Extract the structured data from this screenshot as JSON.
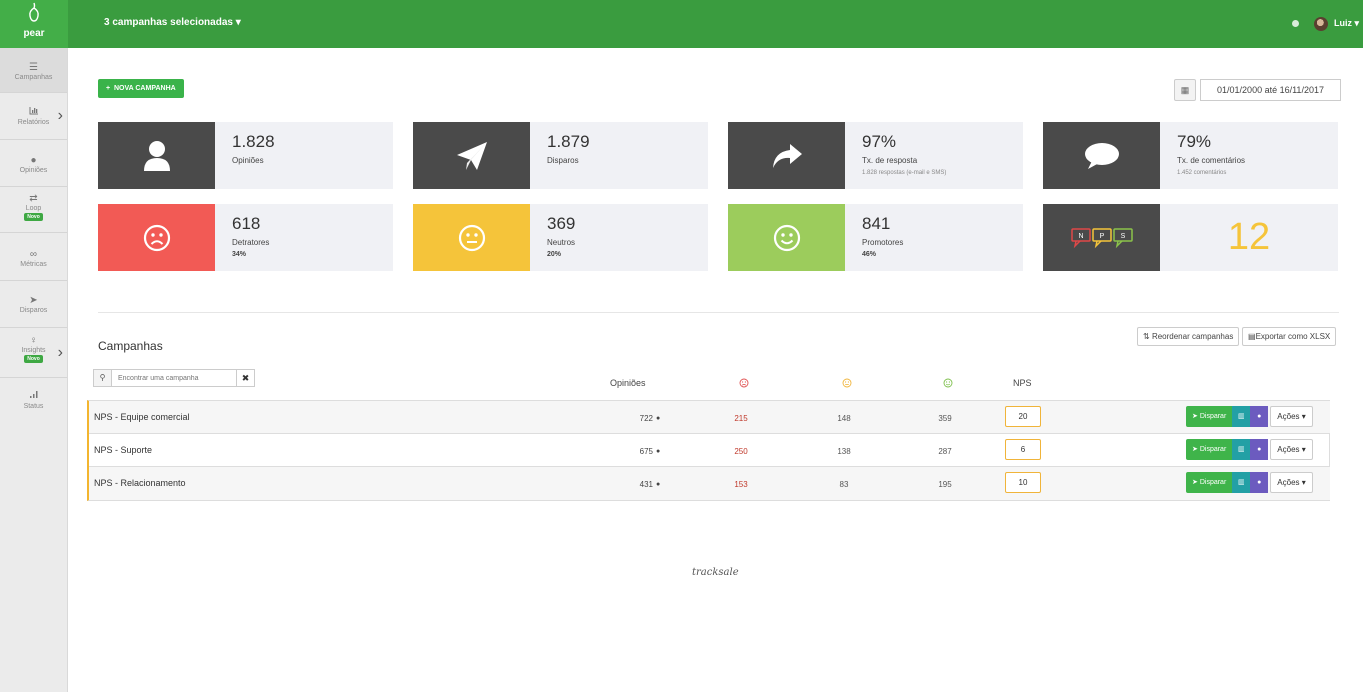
{
  "brand": {
    "name": "pear"
  },
  "topbar": {
    "campaign_selector": "3 campanhas selecionadas",
    "user_name": "Luiz"
  },
  "sidebar": {
    "items": [
      {
        "label": "Campanhas",
        "icon": "menu-icon"
      },
      {
        "label": "Relatórios",
        "icon": "bar-chart-icon"
      },
      {
        "label": "Opiniões",
        "icon": "comment-icon"
      },
      {
        "label": "Loop",
        "badge": "Novo",
        "icon": "loop-icon"
      },
      {
        "label": "Métricas",
        "icon": "binoculars-icon"
      },
      {
        "label": "Disparos",
        "icon": "send-icon"
      },
      {
        "label": "Insights",
        "badge": "Novo",
        "icon": "lightbulb-icon"
      },
      {
        "label": "Status",
        "icon": "signal-icon"
      }
    ]
  },
  "actions": {
    "new_campaign": "NOVA CAMPANHA",
    "date_range": "01/01/2000 até 16/11/2017"
  },
  "cards": {
    "opinioes": {
      "value": "1.828",
      "label": "Opiniões"
    },
    "disparos": {
      "value": "1.879",
      "label": "Disparos"
    },
    "resposta": {
      "value": "97%",
      "label": "Tx. de resposta",
      "sub": "1.828 respostas (e-mail e SMS)"
    },
    "comentarios": {
      "value": "79%",
      "label": "Tx. de comentários",
      "sub": "1.452 comentários"
    },
    "detratores": {
      "value": "618",
      "label": "Detratores",
      "pct": "34%",
      "color": "#f25a55"
    },
    "neutros": {
      "value": "369",
      "label": "Neutros",
      "pct": "20%",
      "color": "#f5c43a"
    },
    "promotores": {
      "value": "841",
      "label": "Promotores",
      "pct": "46%",
      "color": "#9ccc5c"
    },
    "nps": {
      "value": "12",
      "letters": [
        "N",
        "P",
        "S"
      ]
    }
  },
  "campaigns": {
    "title": "Campanhas",
    "reorder_label": "Reordenar campanhas",
    "export_label": "Exportar como XLSX",
    "search_placeholder": "Encontrar uma campanha",
    "columns": {
      "opinioes": "Opiniões",
      "nps": "NPS"
    },
    "rows": [
      {
        "name": "NPS - Equipe comercial",
        "opinioes": "722",
        "detratores": "215",
        "neutros": "148",
        "promotores": "359",
        "nps": "20"
      },
      {
        "name": "NPS - Suporte",
        "opinioes": "675",
        "detratores": "250",
        "neutros": "138",
        "promotores": "287",
        "nps": "6"
      },
      {
        "name": "NPS - Relacionamento",
        "opinioes": "431",
        "detratores": "153",
        "neutros": "83",
        "promotores": "195",
        "nps": "10"
      }
    ],
    "row_actions": {
      "disparar": "Disparar",
      "acoes": "Ações"
    }
  },
  "footer": {
    "brand": "tracksale"
  },
  "colors": {
    "accent": "#3a9c3f",
    "dark_tile": "#4a4a4a",
    "nps_border": "#f0b43a"
  }
}
